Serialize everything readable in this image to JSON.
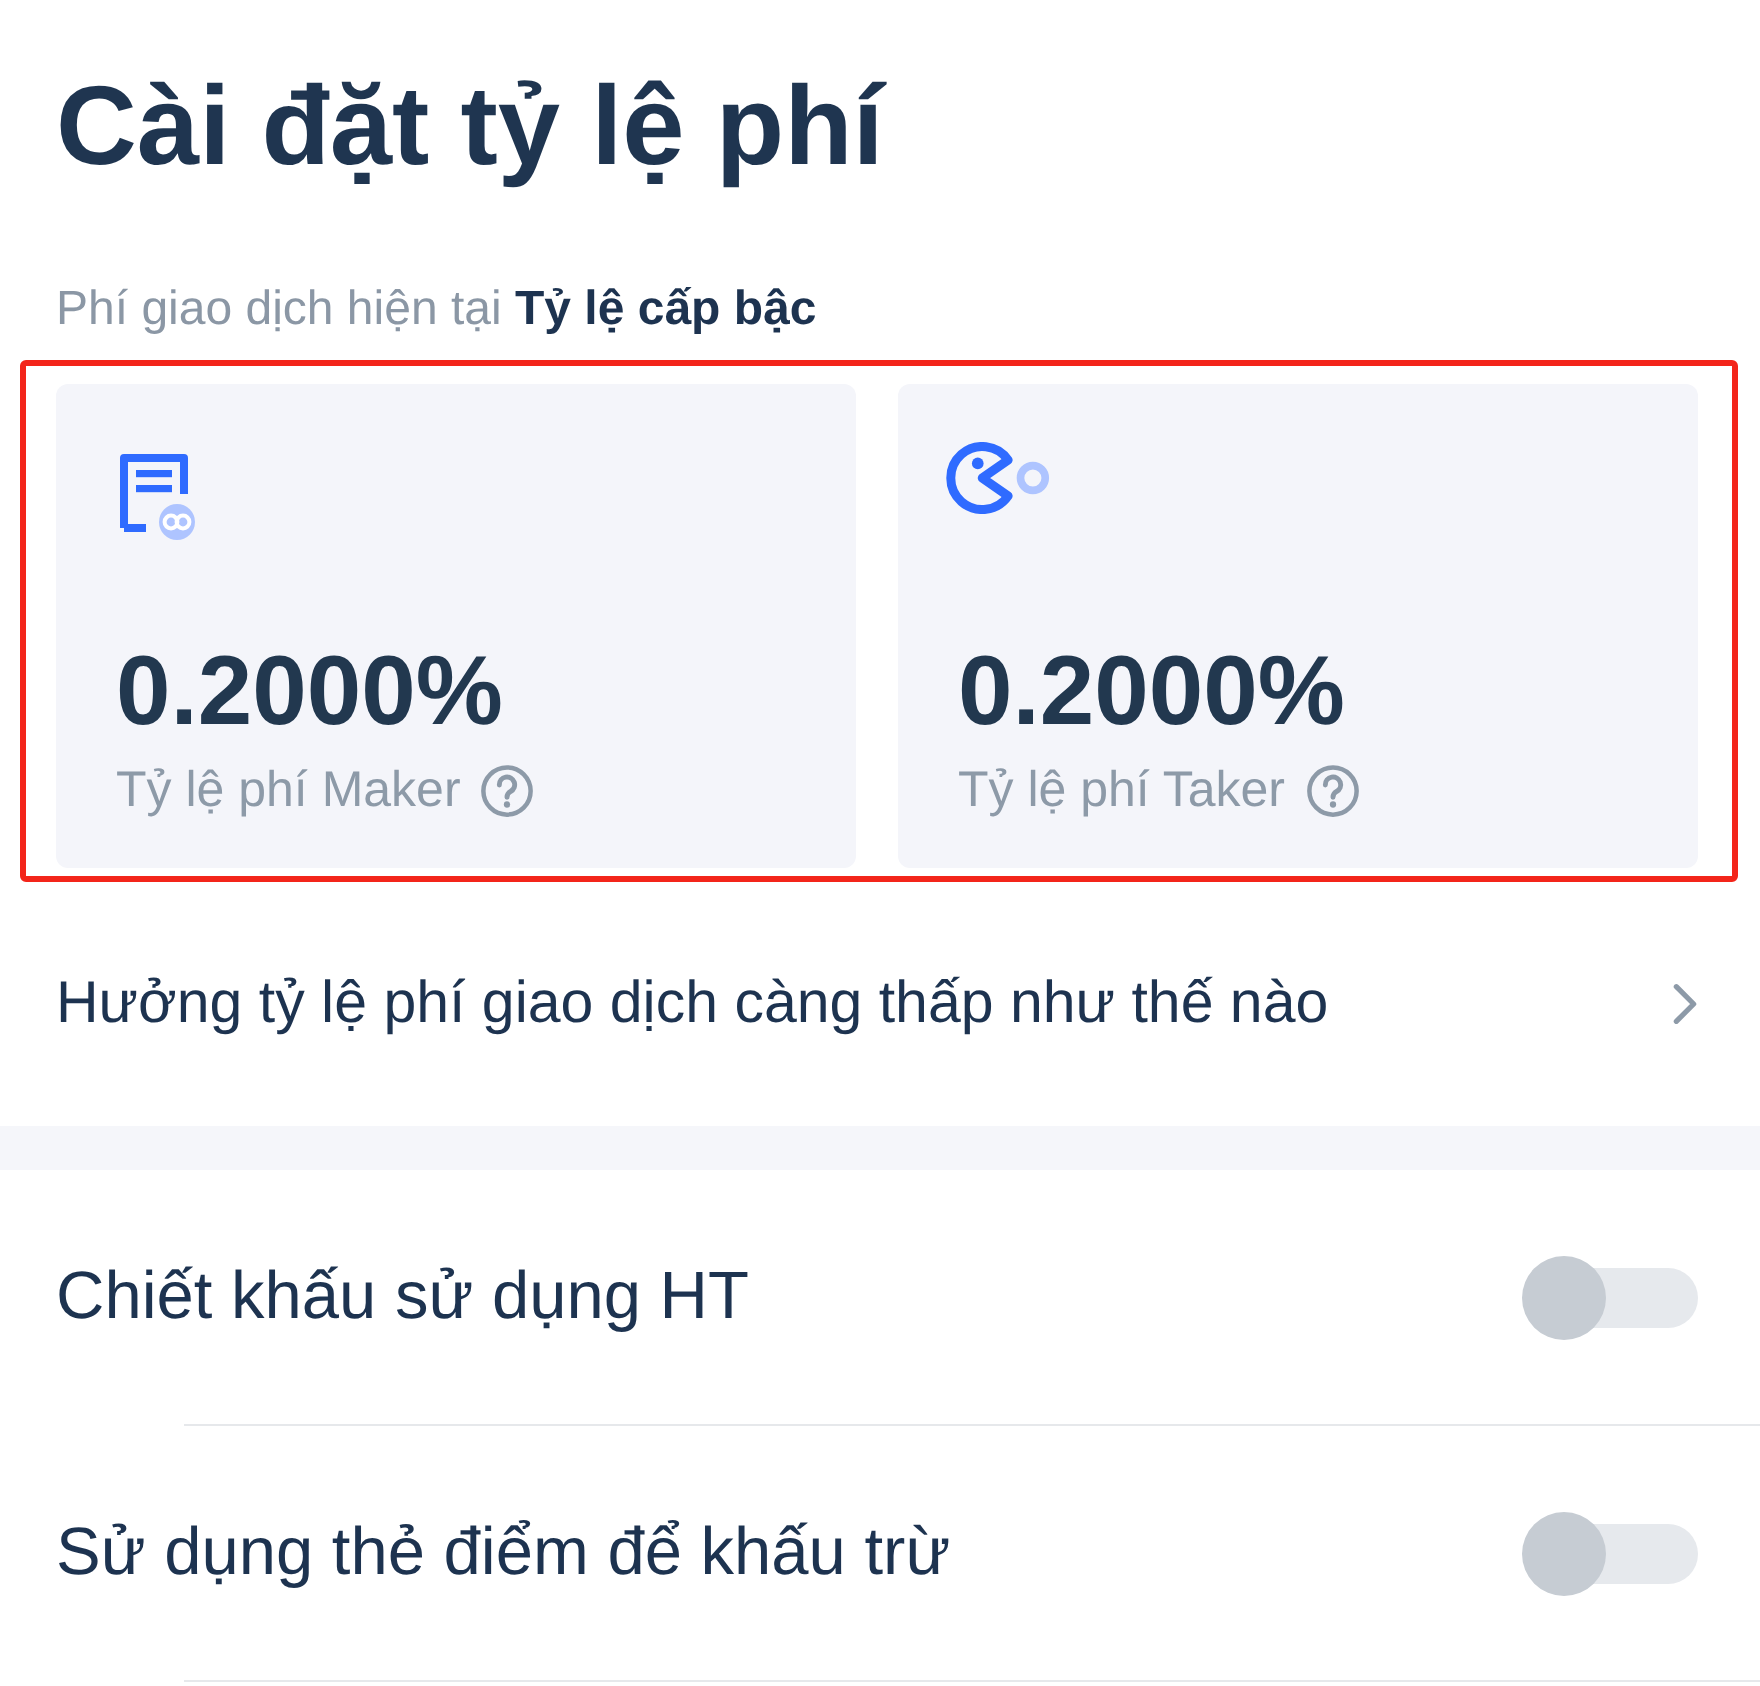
{
  "page": {
    "title": "Cài đặt tỷ lệ phí"
  },
  "current_fee": {
    "text": "Phí giao dịch hiện tại **Tỷ lệ cấp bậc**"
  },
  "fee_cards": {
    "highlighted": true,
    "cards": [
      {
        "kind": "maker",
        "value": "0.2000%",
        "label": "Tỷ lệ phí Maker"
      },
      {
        "kind": "taker",
        "value": "0.2000%",
        "label": "Tỷ lệ phí Taker"
      }
    ]
  },
  "link_row": {
    "label": "Hưởng tỷ lệ phí giao dịch càng thấp như thế nào"
  },
  "toggles": [
    {
      "label": "Chiết khấu sử dụng HT",
      "on": false
    },
    {
      "label": "Sử dụng thẻ điểm để khấu trừ",
      "on": false
    }
  ]
}
